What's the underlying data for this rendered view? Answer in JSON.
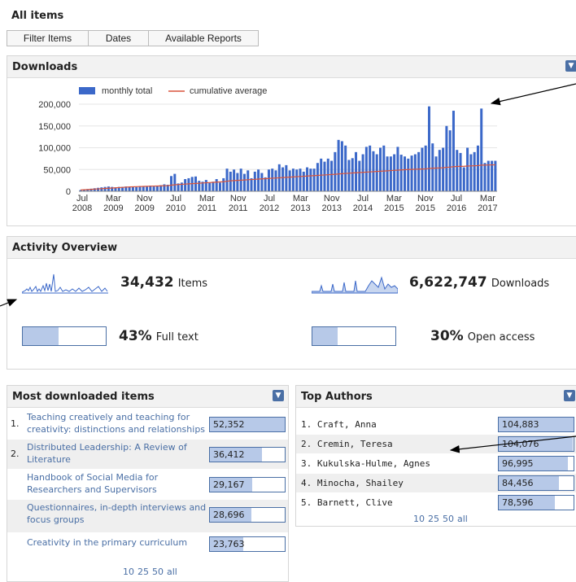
{
  "page_title": "All items",
  "tabs": [
    "Filter Items",
    "Dates",
    "Available Reports"
  ],
  "downloads": {
    "title": "Downloads",
    "legend": {
      "bar": "monthly total",
      "line": "cumulative average"
    },
    "colors": {
      "bar": "#3b68c9",
      "line": "#d9543b"
    }
  },
  "chart_data": {
    "type": "bar",
    "title": "",
    "xlabel": "",
    "ylabel": "",
    "ylim": [
      0,
      200000
    ],
    "yticks": [
      "200,000",
      "150,000",
      "100,000",
      "50,000",
      "0"
    ],
    "xticks": [
      [
        "Jul",
        "2008"
      ],
      [
        "Mar",
        "2009"
      ],
      [
        "Nov",
        "2009"
      ],
      [
        "Jul",
        "2010"
      ],
      [
        "Mar",
        "2011"
      ],
      [
        "Nov",
        "2011"
      ],
      [
        "Jul",
        "2012"
      ],
      [
        "Mar",
        "2013"
      ],
      [
        "Nov",
        "2013"
      ],
      [
        "Jul",
        "2014"
      ],
      [
        "Mar",
        "2015"
      ],
      [
        "Nov",
        "2015"
      ],
      [
        "Jul",
        "2016"
      ],
      [
        "Mar",
        "2017"
      ]
    ],
    "series": [
      {
        "name": "monthly total",
        "type": "bar",
        "values": [
          3000,
          4000,
          5000,
          6000,
          7000,
          8000,
          9000,
          10000,
          11000,
          10000,
          9000,
          10000,
          10000,
          11000,
          10000,
          11000,
          10000,
          12000,
          11000,
          12000,
          13000,
          11000,
          12000,
          14000,
          16000,
          15000,
          35000,
          40000,
          18000,
          20000,
          28000,
          30000,
          33000,
          34000,
          24000,
          22000,
          26000,
          20000,
          22000,
          28000,
          20000,
          30000,
          52000,
          45000,
          50000,
          42000,
          52000,
          40000,
          48000,
          30000,
          45000,
          50000,
          42000,
          32000,
          50000,
          52000,
          48000,
          62000,
          55000,
          60000,
          48000,
          52000,
          50000,
          52000,
          45000,
          55000,
          52000,
          52000,
          65000,
          75000,
          68000,
          75000,
          70000,
          90000,
          118000,
          115000,
          105000,
          72000,
          76000,
          90000,
          70000,
          85000,
          102000,
          105000,
          92000,
          85000,
          100000,
          105000,
          80000,
          80000,
          85000,
          102000,
          84000,
          80000,
          75000,
          82000,
          85000,
          90000,
          100000,
          105000,
          195000,
          110000,
          80000,
          95000,
          100000,
          150000,
          140000,
          185000,
          95000,
          88000,
          55000,
          100000,
          85000,
          90000,
          105000,
          190000,
          65000,
          70000,
          70000,
          70000
        ]
      },
      {
        "name": "cumulative average",
        "type": "line",
        "values": [
          3000,
          3500,
          4000,
          4500,
          5000,
          5500,
          6000,
          6500,
          7000,
          7500,
          8000,
          8500,
          9000,
          9500,
          10000,
          10300,
          10600,
          10900,
          11200,
          11500,
          11800,
          12000,
          12200,
          12400,
          12700,
          13000,
          14000,
          15000,
          15500,
          16000,
          16500,
          17000,
          17500,
          18000,
          18500,
          19000,
          19500,
          20000,
          20500,
          21000,
          21500,
          22000,
          23000,
          24000,
          24500,
          25000,
          25500,
          26000,
          26500,
          27000,
          27500,
          28000,
          28500,
          29000,
          29500,
          30000,
          30500,
          31000,
          31500,
          32000,
          32500,
          33000,
          33500,
          34000,
          34500,
          35000,
          35500,
          36000,
          36500,
          37000,
          37500,
          38000,
          38500,
          39000,
          39700,
          40400,
          41000,
          41500,
          42000,
          42500,
          43000,
          43500,
          44000,
          44500,
          45000,
          45500,
          46000,
          46500,
          47000,
          47500,
          48000,
          48500,
          49000,
          49500,
          50000,
          50300,
          50600,
          50900,
          51200,
          51500,
          52500,
          53000,
          53300,
          53600,
          54000,
          55000,
          55500,
          56500,
          57000,
          57300,
          57500,
          58000,
          58300,
          58600,
          59000,
          60000,
          60200,
          60400,
          60600,
          60800
        ]
      }
    ]
  },
  "activity": {
    "title": "Activity Overview",
    "items": {
      "value": "34,432",
      "label": "Items"
    },
    "downloads": {
      "value": "6,622,747",
      "label": "Downloads"
    },
    "fulltext": {
      "value": "43%",
      "label": "Full text",
      "fraction": 0.43
    },
    "openaccess": {
      "value": "30%",
      "label": "Open access",
      "fraction": 0.3
    }
  },
  "most_downloaded": {
    "title": "Most downloaded items",
    "rows": [
      {
        "rank": "1.",
        "title": "Teaching creatively and teaching for creativity: distinctions and relationships",
        "count": "52,352",
        "fraction": 1.0
      },
      {
        "rank": "2.",
        "title": "Distributed Leadership: A Review of Literature",
        "count": "36,412",
        "fraction": 0.7
      },
      {
        "rank": "",
        "title": "Handbook of Social Media for Researchers and Supervisors",
        "count": "29,167",
        "fraction": 0.56
      },
      {
        "rank": "",
        "title": "Questionnaires, in-depth interviews and focus groups",
        "count": "28,696",
        "fraction": 0.55
      },
      {
        "rank": "",
        "title": "Creativity in the primary curriculum",
        "count": "23,763",
        "fraction": 0.45
      }
    ],
    "pager": [
      "10",
      "25",
      "50",
      "all"
    ]
  },
  "top_authors": {
    "title": "Top Authors",
    "rows": [
      {
        "rank": "1.",
        "name": "Craft, Anna",
        "count": "104,883",
        "fraction": 1.0
      },
      {
        "rank": "2.",
        "name": "Cremin, Teresa",
        "count": "104,076",
        "fraction": 0.99
      },
      {
        "rank": "3.",
        "name": "Kukulska-Hulme, Agnes",
        "count": "96,995",
        "fraction": 0.92
      },
      {
        "rank": "4.",
        "name": "Minocha, Shailey",
        "count": "84,456",
        "fraction": 0.8
      },
      {
        "rank": "5.",
        "name": "Barnett, Clive",
        "count": "78,596",
        "fraction": 0.75
      }
    ],
    "pager": [
      "10",
      "25",
      "50",
      "all"
    ]
  }
}
